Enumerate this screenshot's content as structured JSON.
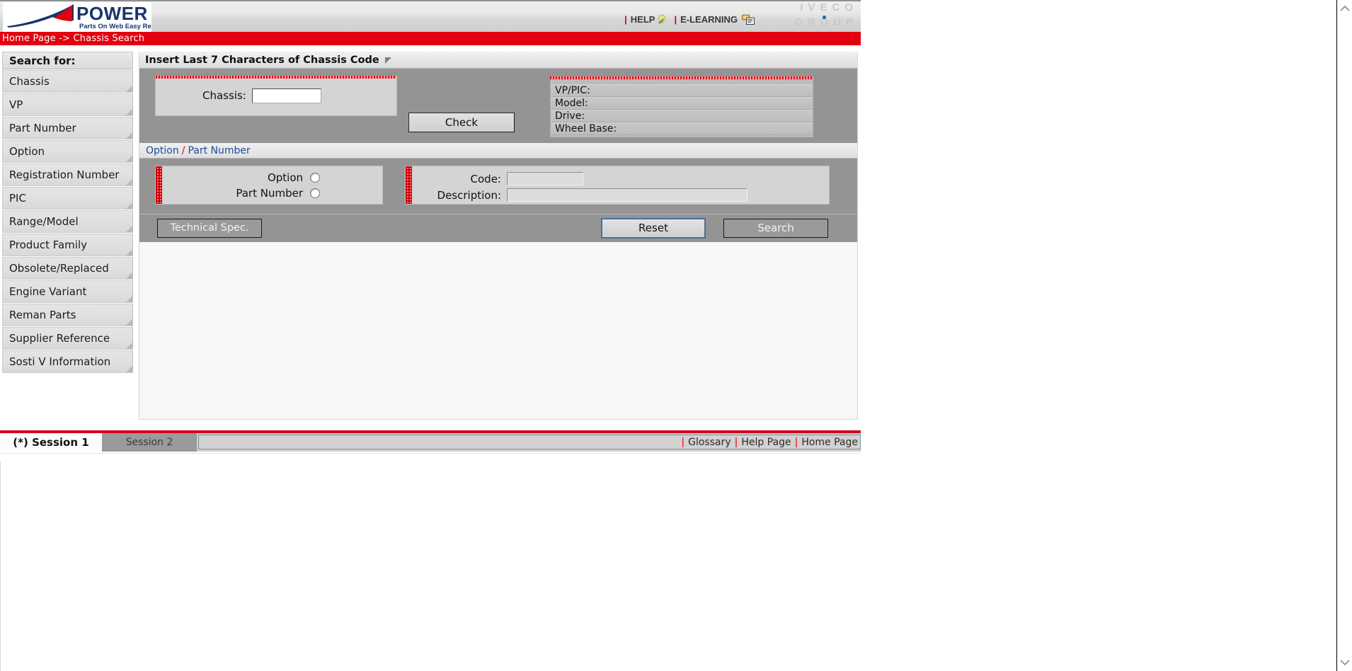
{
  "header": {
    "logo_title": "POWER",
    "logo_tagline": "Parts On Web Easy Research",
    "help_label": "HELP",
    "elearning_label": "E-LEARNING",
    "separator": "|",
    "watermark_line1": "IVECO",
    "watermark_line2": "GROUP",
    "icons": {
      "help": "lightbulb-icon",
      "elearning": "elearning-monitor-icon"
    }
  },
  "breadcrumb": {
    "text": "Home Page -> Chassis Search",
    "home": "Home Page",
    "arrow": "->",
    "current": "Chassis Search"
  },
  "sidebar": {
    "title": "Search for:",
    "items": [
      {
        "label": "Chassis"
      },
      {
        "label": "VP"
      },
      {
        "label": "Part Number"
      },
      {
        "label": "Option"
      },
      {
        "label": "Registration Number"
      },
      {
        "label": "PIC"
      },
      {
        "label": "Range/Model"
      },
      {
        "label": "Product Family"
      },
      {
        "label": "Obsolete/Replaced"
      },
      {
        "label": "Engine Variant"
      },
      {
        "label": "Reman Parts"
      },
      {
        "label": "Supplier Reference"
      },
      {
        "label": "Sosti V Information"
      }
    ]
  },
  "chassis_section": {
    "title": "Insert Last 7 Characters of Chassis Code",
    "chassis_label": "Chassis:",
    "chassis_value": "",
    "chassis_placeholder": "",
    "check_label": "Check",
    "vehicle_info": [
      {
        "label": "VP/PIC:",
        "value": ""
      },
      {
        "label": "Model:",
        "value": ""
      },
      {
        "label": "Drive:",
        "value": ""
      },
      {
        "label": "Wheel Base:",
        "value": ""
      }
    ]
  },
  "option_section": {
    "tab_option": "Option",
    "tab_separator": "/",
    "tab_part_number": "Part Number",
    "radio_option_label": "Option",
    "radio_part_number_label": "Part Number",
    "code_label": "Code:",
    "code_value": "",
    "description_label": "Description:",
    "description_value": ""
  },
  "actions": {
    "technical_spec_label": "Technical Spec.",
    "reset_label": "Reset",
    "search_label": "Search"
  },
  "footer": {
    "session1_label": "(*) Session 1",
    "session2_label": "Session 2",
    "separator": "|",
    "glossary_label": "Glossary",
    "help_page_label": "Help Page",
    "home_page_label": "Home Page"
  },
  "colors": {
    "brand_red": "#e3000f",
    "brand_blue": "#1f4a9b",
    "panel_gray": "#949494",
    "link_blue": "#1f4a9b"
  }
}
